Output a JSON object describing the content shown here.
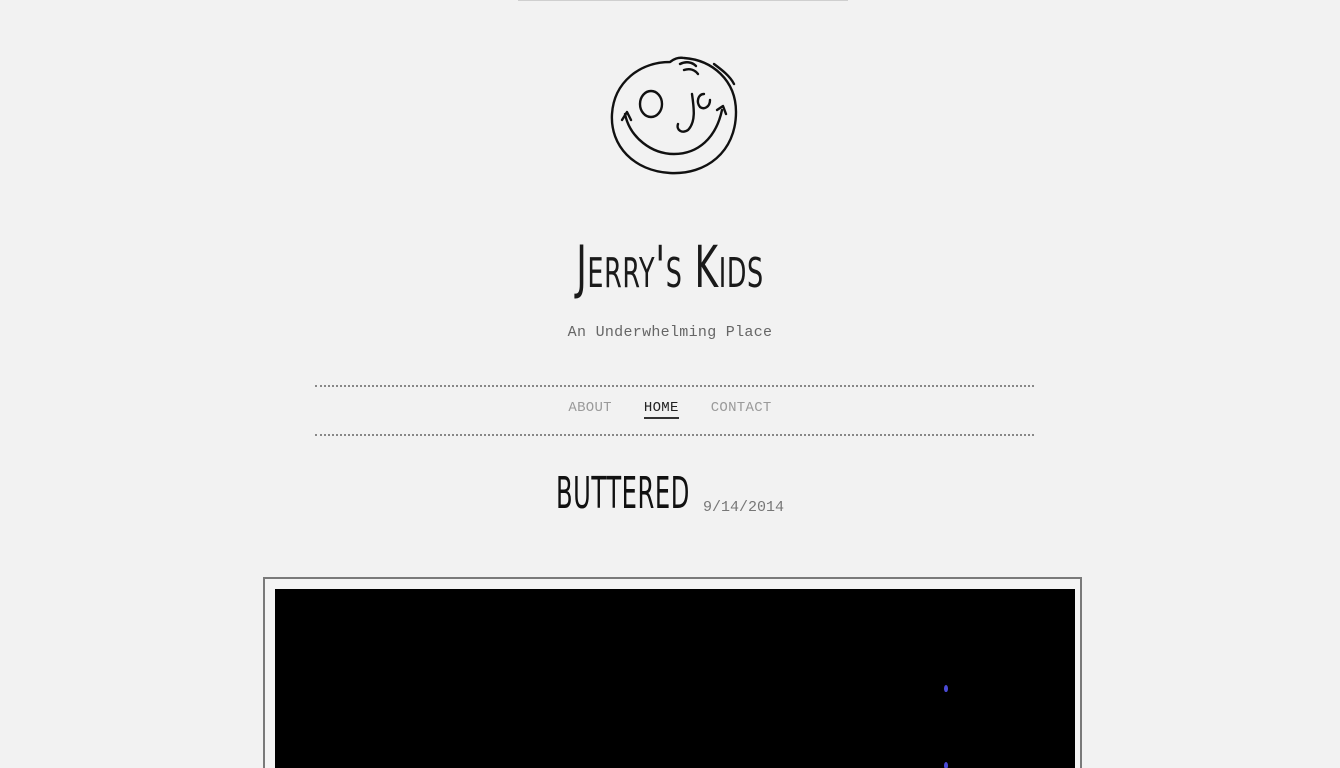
{
  "site": {
    "title": "Jerry's Kids",
    "tagline": "An Underwhelming Place",
    "logo_icon": "smiley-face-icon"
  },
  "nav": {
    "items": [
      {
        "label": "ABOUT",
        "active": false
      },
      {
        "label": "HOME",
        "active": true
      },
      {
        "label": "CONTACT",
        "active": false
      }
    ]
  },
  "post": {
    "title": "BUTTERED",
    "date": "9/14/2014"
  },
  "colors": {
    "background": "#f2f2f2",
    "text": "#222222",
    "nav_inactive": "#9a9a9a",
    "media_background": "#000000",
    "media_accent": "#4a4ad6"
  }
}
